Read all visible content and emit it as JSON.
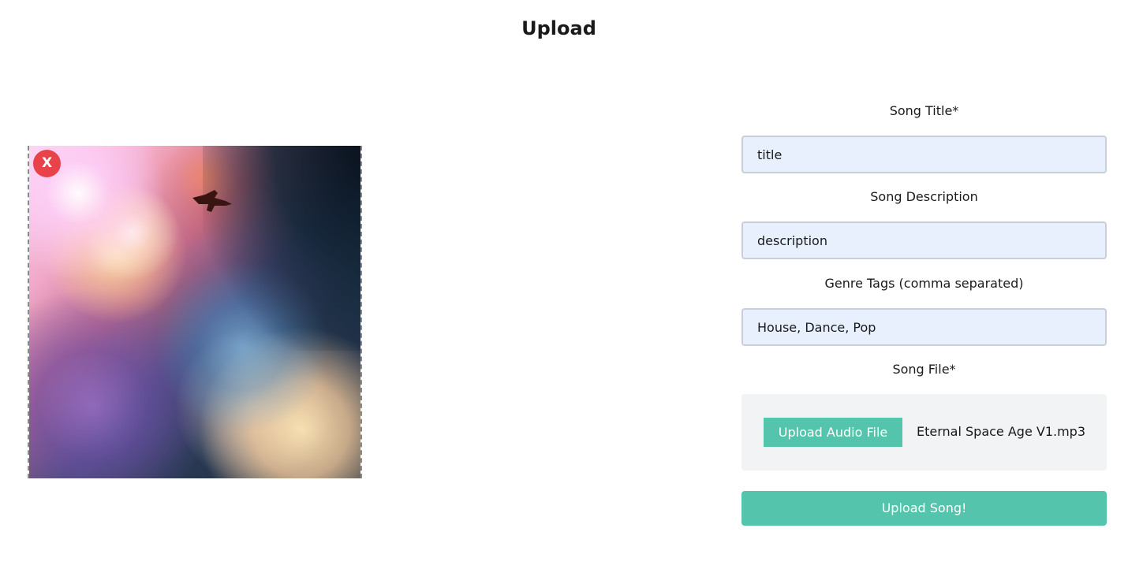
{
  "page": {
    "title": "Upload"
  },
  "cover": {
    "remove_label": "X"
  },
  "form": {
    "title_label": "Song Title*",
    "title_value": "title",
    "description_label": "Song Description",
    "description_value": "description",
    "tags_label": "Genre Tags (comma separated)",
    "tags_value": "House, Dance, Pop",
    "file_label": "Song File*",
    "file_button_label": "Upload Audio File",
    "file_name": "Eternal Space Age V1.mp3",
    "submit_label": "Upload Song!"
  },
  "colors": {
    "accent": "#55c4ac",
    "remove": "#e8424a",
    "input_bg": "#e8f0fe",
    "file_box_bg": "#f1f3f5"
  }
}
